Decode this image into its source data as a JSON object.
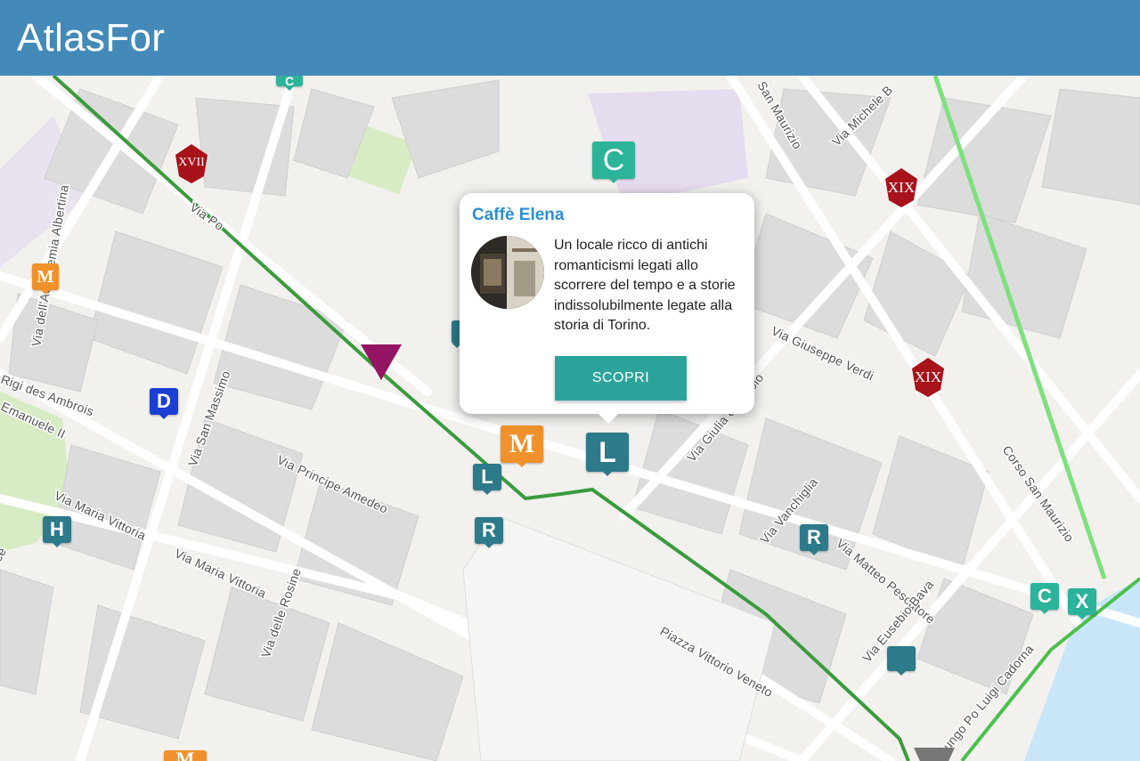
{
  "header": {
    "title": "AtlasFor"
  },
  "map": {
    "colors": {
      "route": "#3a9b3d",
      "route_light": "#7ee07e",
      "marker_teal": "#2d7a8a",
      "marker_green": "#2bb49a",
      "marker_orange": "#f0912b",
      "marker_red": "#a8121a",
      "marker_blue": "#1b3fd4"
    },
    "streets": [
      "Via Po",
      "Via dell'Accademia Albertina",
      "Via San Massimo",
      "Via Principe Amedeo",
      "Via Maria Vittoria",
      "Via Maria Vittoria",
      "Via delle Rosine",
      "Piazza Vittorio Veneto",
      "Via Giuseppe Verdi",
      "Via Giulia di Barolo",
      "Via Vanchiglia",
      "Via Matteo Pescatore",
      "Via Eusebio Bava",
      "Corso San Maurizio",
      "San Maurizio",
      "Via Michele B",
      "Lungo Po Luigi Cadorna",
      "Rigi des Ambrois",
      "Emanuele II",
      "ce"
    ],
    "markers": [
      {
        "glyph": "XVII",
        "type": "pentagon-red-marker"
      },
      {
        "glyph": "XIX",
        "type": "pentagon-red-marker"
      },
      {
        "glyph": "XIX",
        "type": "pentagon-red-marker"
      },
      {
        "glyph": "M",
        "type": "orange-m-marker"
      },
      {
        "glyph": "M",
        "type": "orange-m-marker"
      },
      {
        "glyph": "M",
        "type": "orange-m-marker"
      },
      {
        "glyph": "D",
        "type": "blue-d-marker"
      },
      {
        "glyph": "H",
        "type": "teal-h-marker"
      },
      {
        "glyph": "L",
        "type": "teal-l-marker"
      },
      {
        "glyph": "L",
        "type": "teal-l-marker"
      },
      {
        "glyph": "R",
        "type": "teal-r-marker"
      },
      {
        "glyph": "R",
        "type": "teal-r-marker"
      },
      {
        "glyph": "C",
        "type": "green-c-marker"
      },
      {
        "glyph": "C",
        "type": "green-c-marker"
      },
      {
        "glyph": "C",
        "type": "green-c-marker"
      },
      {
        "glyph": "X",
        "type": "green-x-marker"
      }
    ]
  },
  "popup": {
    "title": "Caffè Elena",
    "description": "Un locale ricco di antichi romanticismi legati allo scorrere del tempo e a storie indissolubilmente legate alla storia di Torino.",
    "button_label": "SCOPRI"
  }
}
